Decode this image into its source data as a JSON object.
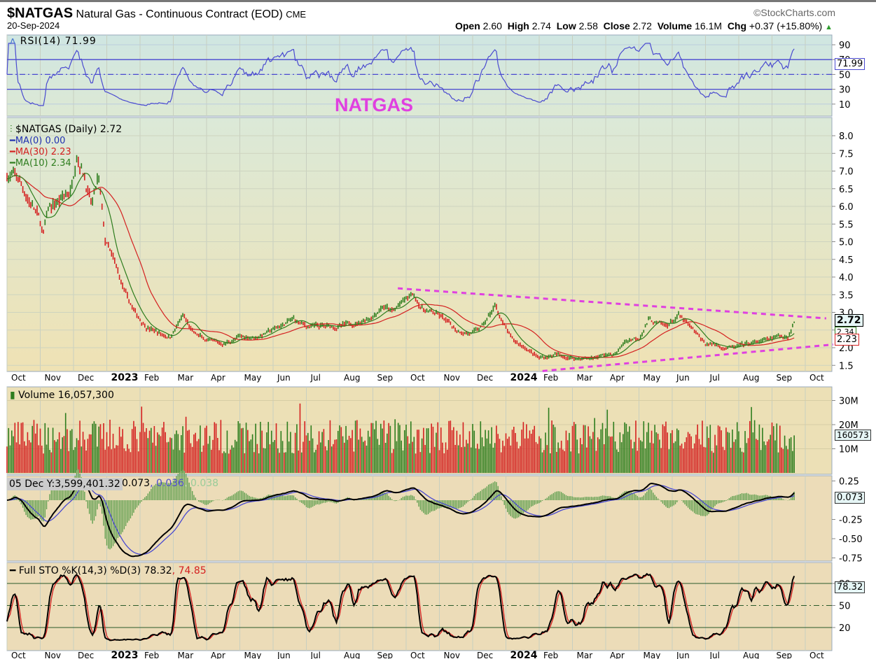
{
  "header": {
    "symbol": "$NATGAS",
    "name": "Natural Gas - Continuous Contract (EOD)",
    "exchange": "CME",
    "date": "20-Sep-2024",
    "brand": "©StockCharts.com",
    "open_label": "Open",
    "open": "2.60",
    "high_label": "High",
    "high": "2.74",
    "low_label": "Low",
    "low": "2.58",
    "close_label": "Close",
    "close": "2.72",
    "volume_label": "Volume",
    "volume": "16.1M",
    "chg_label": "Chg",
    "chg": "+0.37 (+15.80%)",
    "up_arrow": "▲"
  },
  "annotation": "NATGAS",
  "colors": {
    "up": "#2e7d1e",
    "down": "#d42020",
    "ma30": "#d42020",
    "ma10": "#2e7d1e",
    "trend": "#e040e0",
    "rsi": "#4a4ad0"
  },
  "chart_data": {
    "type": "line",
    "title": "$NATGAS (Daily)",
    "x_month_labels": [
      "Oct",
      "Nov",
      "Dec",
      "2023",
      "Feb",
      "Mar",
      "Apr",
      "May",
      "Jun",
      "Jul",
      "Aug",
      "Sep",
      "Oct",
      "Nov",
      "Dec",
      "2024",
      "Feb",
      "Mar",
      "Apr",
      "May",
      "Jun",
      "Jul",
      "Aug",
      "Sep",
      "Oct"
    ],
    "bold_labels": [
      "2023",
      "2024"
    ],
    "last_month": 23.65,
    "keypoints": [
      [
        0,
        6.9
      ],
      [
        0.3,
        6.8
      ],
      [
        0.6,
        6.3
      ],
      [
        0.9,
        5.8
      ],
      [
        1.1,
        5.2
      ],
      [
        1.25,
        5.9
      ],
      [
        1.6,
        6.2
      ],
      [
        1.9,
        6.4
      ],
      [
        2.1,
        7.6
      ],
      [
        2.3,
        7.0
      ],
      [
        2.55,
        6.0
      ],
      [
        2.75,
        6.8
      ],
      [
        2.95,
        5.0
      ],
      [
        3.3,
        4.2
      ],
      [
        3.6,
        3.4
      ],
      [
        3.9,
        2.9
      ],
      [
        4.2,
        2.6
      ],
      [
        4.6,
        2.4
      ],
      [
        4.9,
        2.3
      ],
      [
        5.1,
        2.6
      ],
      [
        5.3,
        2.9
      ],
      [
        5.6,
        2.4
      ],
      [
        6.0,
        2.2
      ],
      [
        6.5,
        2.1
      ],
      [
        7.0,
        2.3
      ],
      [
        7.5,
        2.3
      ],
      [
        8.0,
        2.5
      ],
      [
        8.6,
        2.8
      ],
      [
        9.0,
        2.6
      ],
      [
        9.6,
        2.6
      ],
      [
        10.0,
        2.6
      ],
      [
        10.5,
        2.7
      ],
      [
        11.0,
        2.9
      ],
      [
        11.3,
        3.2
      ],
      [
        11.6,
        3.0
      ],
      [
        11.9,
        3.3
      ],
      [
        12.2,
        3.5
      ],
      [
        12.5,
        3.1
      ],
      [
        13.0,
        2.9
      ],
      [
        13.5,
        2.5
      ],
      [
        14.0,
        2.4
      ],
      [
        14.3,
        2.6
      ],
      [
        14.7,
        3.2
      ],
      [
        14.9,
        2.7
      ],
      [
        15.2,
        2.2
      ],
      [
        15.6,
        2.0
      ],
      [
        16.0,
        1.7
      ],
      [
        16.5,
        1.8
      ],
      [
        17.0,
        1.7
      ],
      [
        17.5,
        1.7
      ],
      [
        18.0,
        1.8
      ],
      [
        18.3,
        1.8
      ],
      [
        18.6,
        2.2
      ],
      [
        19.0,
        2.3
      ],
      [
        19.3,
        2.8
      ],
      [
        19.5,
        2.7
      ],
      [
        19.8,
        2.6
      ],
      [
        20.2,
        2.9
      ],
      [
        20.6,
        2.5
      ],
      [
        21.0,
        2.1
      ],
      [
        21.3,
        2.1
      ],
      [
        21.6,
        2.0
      ],
      [
        21.9,
        2.0
      ],
      [
        22.3,
        2.1
      ],
      [
        22.8,
        2.2
      ],
      [
        23.2,
        2.3
      ],
      [
        23.5,
        2.35
      ],
      [
        23.65,
        2.72
      ]
    ],
    "trendlines": [
      {
        "name": "upper",
        "from": [
          11.75,
          3.68
        ],
        "to": [
          24.63,
          2.83
        ]
      },
      {
        "name": "lower",
        "from": [
          16.1,
          1.34
        ],
        "to": [
          24.84,
          2.09
        ]
      }
    ],
    "price_axis": {
      "ylim": [
        1.3,
        8.3
      ],
      "ticks": [
        "8.0",
        "7.5",
        "7.0",
        "6.5",
        "6.0",
        "5.5",
        "5.0",
        "4.5",
        "4.0",
        "3.5",
        "3.0",
        "2.5",
        "2.0",
        "1.5"
      ]
    },
    "rsi": {
      "label": "RSI(14) 71.99",
      "value": "71.99",
      "ticks": [
        "90",
        "70",
        "50",
        "30",
        "10"
      ],
      "levels": [
        70,
        50,
        30
      ]
    },
    "price_legend": {
      "main": "$NATGAS (Daily) 2.72",
      "ma0": "MA(0) 0.00",
      "ma30": "MA(30) 2.23",
      "ma10": "MA(10) 2.34",
      "tag_close": "2.72",
      "tag_ma10": "2.34",
      "tag_ma30": "2.23"
    },
    "volume": {
      "label": "Volume 16,057,300",
      "ticks": [
        "30M",
        "20M",
        "10M"
      ],
      "tag": "160573",
      "range_M": [
        8,
        22
      ]
    },
    "macd": {
      "cursor": "05 Dec Y:3,599,401.32",
      "v1": "0.073",
      "sep": ", ",
      "v2": "0.036",
      "v3": "0.038",
      "ticks": [
        "0.25",
        "-0.25",
        "-0.50",
        "-0.75"
      ],
      "tag": "0.073"
    },
    "sto": {
      "label": "Full STO %K(14,3) %D(3) 78.32",
      "d_value": "74.85",
      "sep": ", ",
      "ticks": [
        "80",
        "50",
        "20"
      ],
      "tag": "78.32",
      "levels": [
        80,
        50,
        20
      ]
    }
  }
}
